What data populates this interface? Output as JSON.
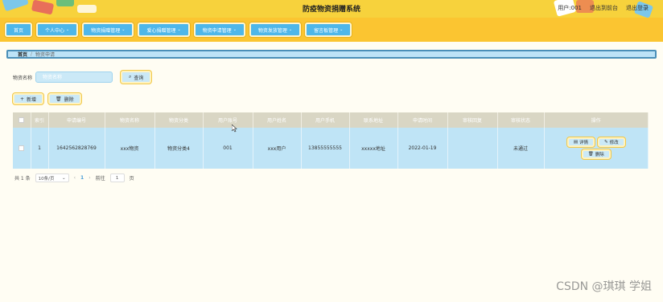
{
  "header": {
    "title": "防疫物资捐赠系统",
    "user_label": "用户:001",
    "back_label": "退出到前台",
    "logout_label": "退出登录"
  },
  "nav": [
    {
      "label": "首页",
      "has_dropdown": false
    },
    {
      "label": "个人中心",
      "has_dropdown": true
    },
    {
      "label": "物资捐赠管理",
      "has_dropdown": true
    },
    {
      "label": "爱心捐赠管理",
      "has_dropdown": true
    },
    {
      "label": "物资申请管理",
      "has_dropdown": true
    },
    {
      "label": "物资发放管理",
      "has_dropdown": true
    },
    {
      "label": "留言板管理",
      "has_dropdown": true
    }
  ],
  "breadcrumb": {
    "home": "首页",
    "separator": "/",
    "current": "物资申请"
  },
  "search": {
    "label": "物资名称",
    "placeholder": "物资名称",
    "value": "",
    "button": "查询"
  },
  "actions": {
    "add": "新增",
    "delete": "删除"
  },
  "table": {
    "columns": [
      "",
      "索引",
      "申请编号",
      "物资名称",
      "物资分类",
      "用户账号",
      "用户姓名",
      "用户手机",
      "联系地址",
      "申请时间",
      "审核回复",
      "审核状态",
      "操作"
    ],
    "rows": [
      {
        "index": "1",
        "apply_no": "1642562828769",
        "name": "xxx物资",
        "category": "物资分类4",
        "account": "001",
        "username": "xxx用户",
        "phone": "13855555555",
        "address": "xxxxx地址",
        "apply_time": "2022-01-19",
        "reply": "",
        "status": "未通过"
      }
    ],
    "row_ops": {
      "detail": "详情",
      "edit": "修改",
      "delete": "删除"
    }
  },
  "pager": {
    "total": "共 1 条",
    "page_size": "10条/页",
    "current_page": "1",
    "goto_label": "前往",
    "goto_value": "1",
    "page_suffix": "页"
  },
  "watermark": "CSDN @琪琪 学姐",
  "colors": {
    "header_bg": "#f7d23c",
    "nav_bg": "#fbc531",
    "nav_item": "#4fb7e9",
    "row_bg": "#bfe4f6",
    "head_bg": "#d9d6c4"
  }
}
